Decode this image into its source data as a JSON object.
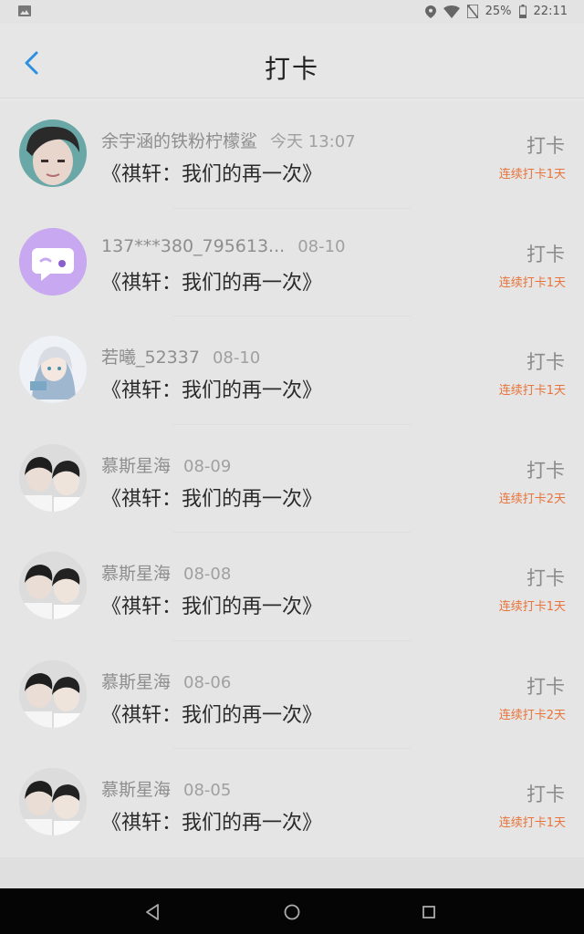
{
  "status_bar": {
    "battery": "25%",
    "time": "22:11"
  },
  "header": {
    "title": "打卡"
  },
  "rows": [
    {
      "user": "余宇涵的铁粉柠檬鲨",
      "time": "今天 13:07",
      "book": "《祺轩：我们的再一次》",
      "action": "打卡",
      "streak": "连续打卡1天",
      "avatar": "avatar-portrait"
    },
    {
      "user": "137***380_795613...",
      "time": "08-10",
      "book": "《祺轩：我们的再一次》",
      "action": "打卡",
      "streak": "连续打卡1天",
      "avatar": "chat-bubble-icon"
    },
    {
      "user": "若曦_52337",
      "time": "08-10",
      "book": "《祺轩：我们的再一次》",
      "action": "打卡",
      "streak": "连续打卡1天",
      "avatar": "avatar-anime"
    },
    {
      "user": "慕斯星海",
      "time": "08-09",
      "book": "《祺轩：我们的再一次》",
      "action": "打卡",
      "streak": "连续打卡2天",
      "avatar": "avatar-two-people"
    },
    {
      "user": "慕斯星海",
      "time": "08-08",
      "book": "《祺轩：我们的再一次》",
      "action": "打卡",
      "streak": "连续打卡1天",
      "avatar": "avatar-two-people"
    },
    {
      "user": "慕斯星海",
      "time": "08-06",
      "book": "《祺轩：我们的再一次》",
      "action": "打卡",
      "streak": "连续打卡2天",
      "avatar": "avatar-two-people"
    },
    {
      "user": "慕斯星海",
      "time": "08-05",
      "book": "《祺轩：我们的再一次》",
      "action": "打卡",
      "streak": "连续打卡1天",
      "avatar": "avatar-two-people"
    }
  ],
  "colors": {
    "accent": "#2d8fe0",
    "streak": "#e8743b",
    "chat_avatar_bg": "#c8a8f0"
  }
}
